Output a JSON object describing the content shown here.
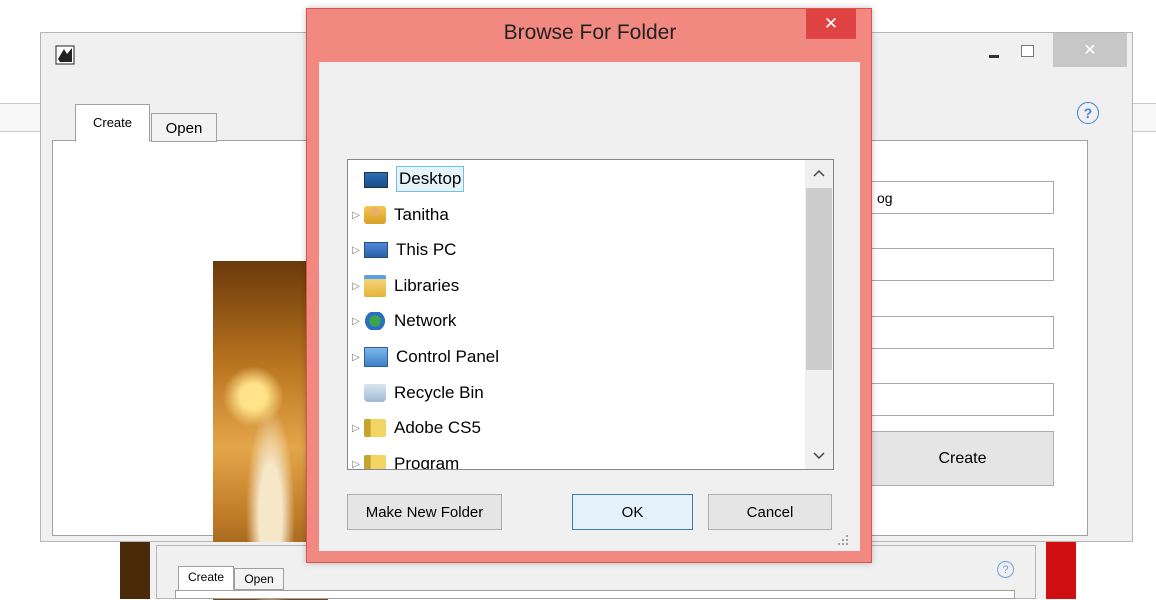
{
  "main_window": {
    "tabs": [
      {
        "label": "Create"
      },
      {
        "label": "Open"
      }
    ],
    "help": "?",
    "field_1_value": "og",
    "create_label": "Create"
  },
  "second_window": {
    "tabs": [
      {
        "label": "Create"
      },
      {
        "label": "Open"
      }
    ],
    "help": "?"
  },
  "dialog": {
    "title": "Browse For Folder",
    "close": "✕",
    "tree": [
      {
        "label": "Desktop",
        "icon": "desktop-icon",
        "selected": true
      },
      {
        "label": "Tanitha",
        "icon": "user-folder-icon"
      },
      {
        "label": "This PC",
        "icon": "computer-icon"
      },
      {
        "label": "Libraries",
        "icon": "libraries-icon"
      },
      {
        "label": "Network",
        "icon": "network-icon"
      },
      {
        "label": "Control Panel",
        "icon": "control-panel-icon"
      },
      {
        "label": "Recycle Bin",
        "icon": "recycle-bin-icon"
      },
      {
        "label": "Adobe CS5",
        "icon": "folder-icon"
      },
      {
        "label": "Program",
        "icon": "folder-icon"
      }
    ],
    "buttons": {
      "new_folder": "Make New Folder",
      "ok": "OK",
      "cancel": "Cancel"
    }
  }
}
